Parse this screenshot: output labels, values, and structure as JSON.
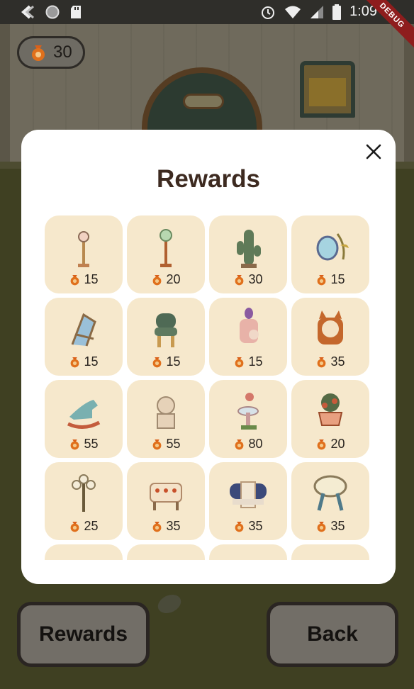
{
  "status_bar": {
    "time": "1:09",
    "debug_banner": "DEBUG",
    "left_icons": [
      "back-arrow-icon",
      "circle-icon",
      "sd-card-icon"
    ],
    "right_icons": [
      "alarm-icon",
      "wifi-icon",
      "signal-icon",
      "battery-icon"
    ]
  },
  "hud": {
    "coin_count": "30"
  },
  "modal": {
    "title": "Rewards",
    "close_icon": "close-icon",
    "items": [
      {
        "icon": "lamp-post-icon",
        "price": "15"
      },
      {
        "icon": "globe-lamp-icon",
        "price": "20"
      },
      {
        "icon": "cactus-icon",
        "price": "30"
      },
      {
        "icon": "hanging-birdcage-icon",
        "price": "15"
      },
      {
        "icon": "deck-chair-icon",
        "price": "15"
      },
      {
        "icon": "green-chair-icon",
        "price": "15"
      },
      {
        "icon": "bunny-armchair-icon",
        "price": "15"
      },
      {
        "icon": "cat-cushion-icon",
        "price": "35"
      },
      {
        "icon": "rocking-horse-icon",
        "price": "55"
      },
      {
        "icon": "lion-statue-icon",
        "price": "55"
      },
      {
        "icon": "flower-fountain-icon",
        "price": "80"
      },
      {
        "icon": "teacup-plant-icon",
        "price": "20"
      },
      {
        "icon": "flower-lamp-icon",
        "price": "25"
      },
      {
        "icon": "strawberry-table-icon",
        "price": "35"
      },
      {
        "icon": "sofa-icon",
        "price": "35"
      },
      {
        "icon": "round-table-icon",
        "price": "35"
      },
      {
        "icon": "item-icon",
        "price": ""
      },
      {
        "icon": "item-icon",
        "price": ""
      },
      {
        "icon": "item-icon",
        "price": ""
      },
      {
        "icon": "item-icon",
        "price": ""
      }
    ]
  },
  "buttons": {
    "rewards": "Rewards",
    "back": "Back"
  },
  "colors": {
    "card_bg": "#f6e8cc",
    "title": "#3d2a20",
    "coin": "#e0701c",
    "modal_bg": "#ffffff"
  }
}
